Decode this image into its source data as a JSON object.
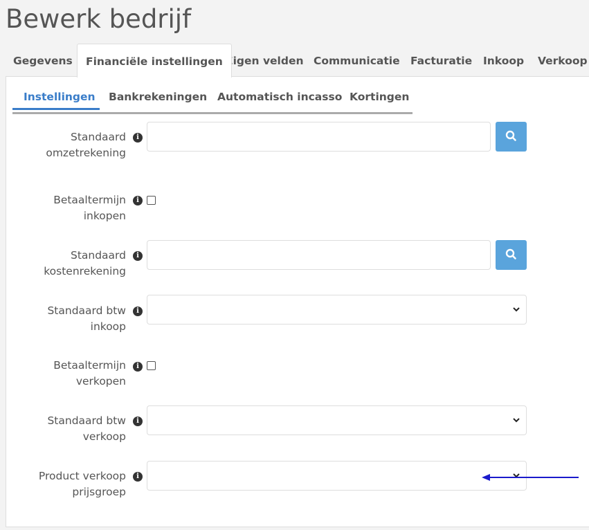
{
  "page": {
    "title": "Bewerk bedrijf"
  },
  "main_tabs": [
    {
      "label": "Gegevens"
    },
    {
      "label": "Financiële instellingen"
    },
    {
      "label": "Eigen velden"
    },
    {
      "label": "Communicatie"
    },
    {
      "label": "Facturatie"
    },
    {
      "label": "Inkoop"
    },
    {
      "label": "Verkoop"
    }
  ],
  "sub_tabs": [
    {
      "label": "Instellingen"
    },
    {
      "label": "Bankrekeningen"
    },
    {
      "label": "Automatisch incasso"
    },
    {
      "label": "Kortingen"
    }
  ],
  "fields": {
    "omzetrekening": {
      "label_line1": "Standaard",
      "label_line2": "omzetrekening",
      "value": ""
    },
    "betaaltermijn_inkopen": {
      "label_line1": "Betaaltermijn",
      "label_line2": "inkopen",
      "checked": false
    },
    "kostenrekening": {
      "label_line1": "Standaard",
      "label_line2": "kostenrekening",
      "value": ""
    },
    "btw_inkoop": {
      "label_line1": "Standaard btw",
      "label_line2": "inkoop",
      "value": ""
    },
    "betaaltermijn_verkopen": {
      "label_line1": "Betaaltermijn",
      "label_line2": "verkopen",
      "checked": false
    },
    "btw_verkoop": {
      "label_line1": "Standaard btw",
      "label_line2": "verkoop",
      "value": ""
    },
    "prijsgroep": {
      "label_line1": "Product verkoop",
      "label_line2": "prijsgroep",
      "value": ""
    }
  },
  "icons": {
    "info": "i"
  },
  "colors": {
    "accent": "#3a7dc9",
    "search_button": "#5aa4dc",
    "annotation_arrow": "#1a1acc"
  }
}
